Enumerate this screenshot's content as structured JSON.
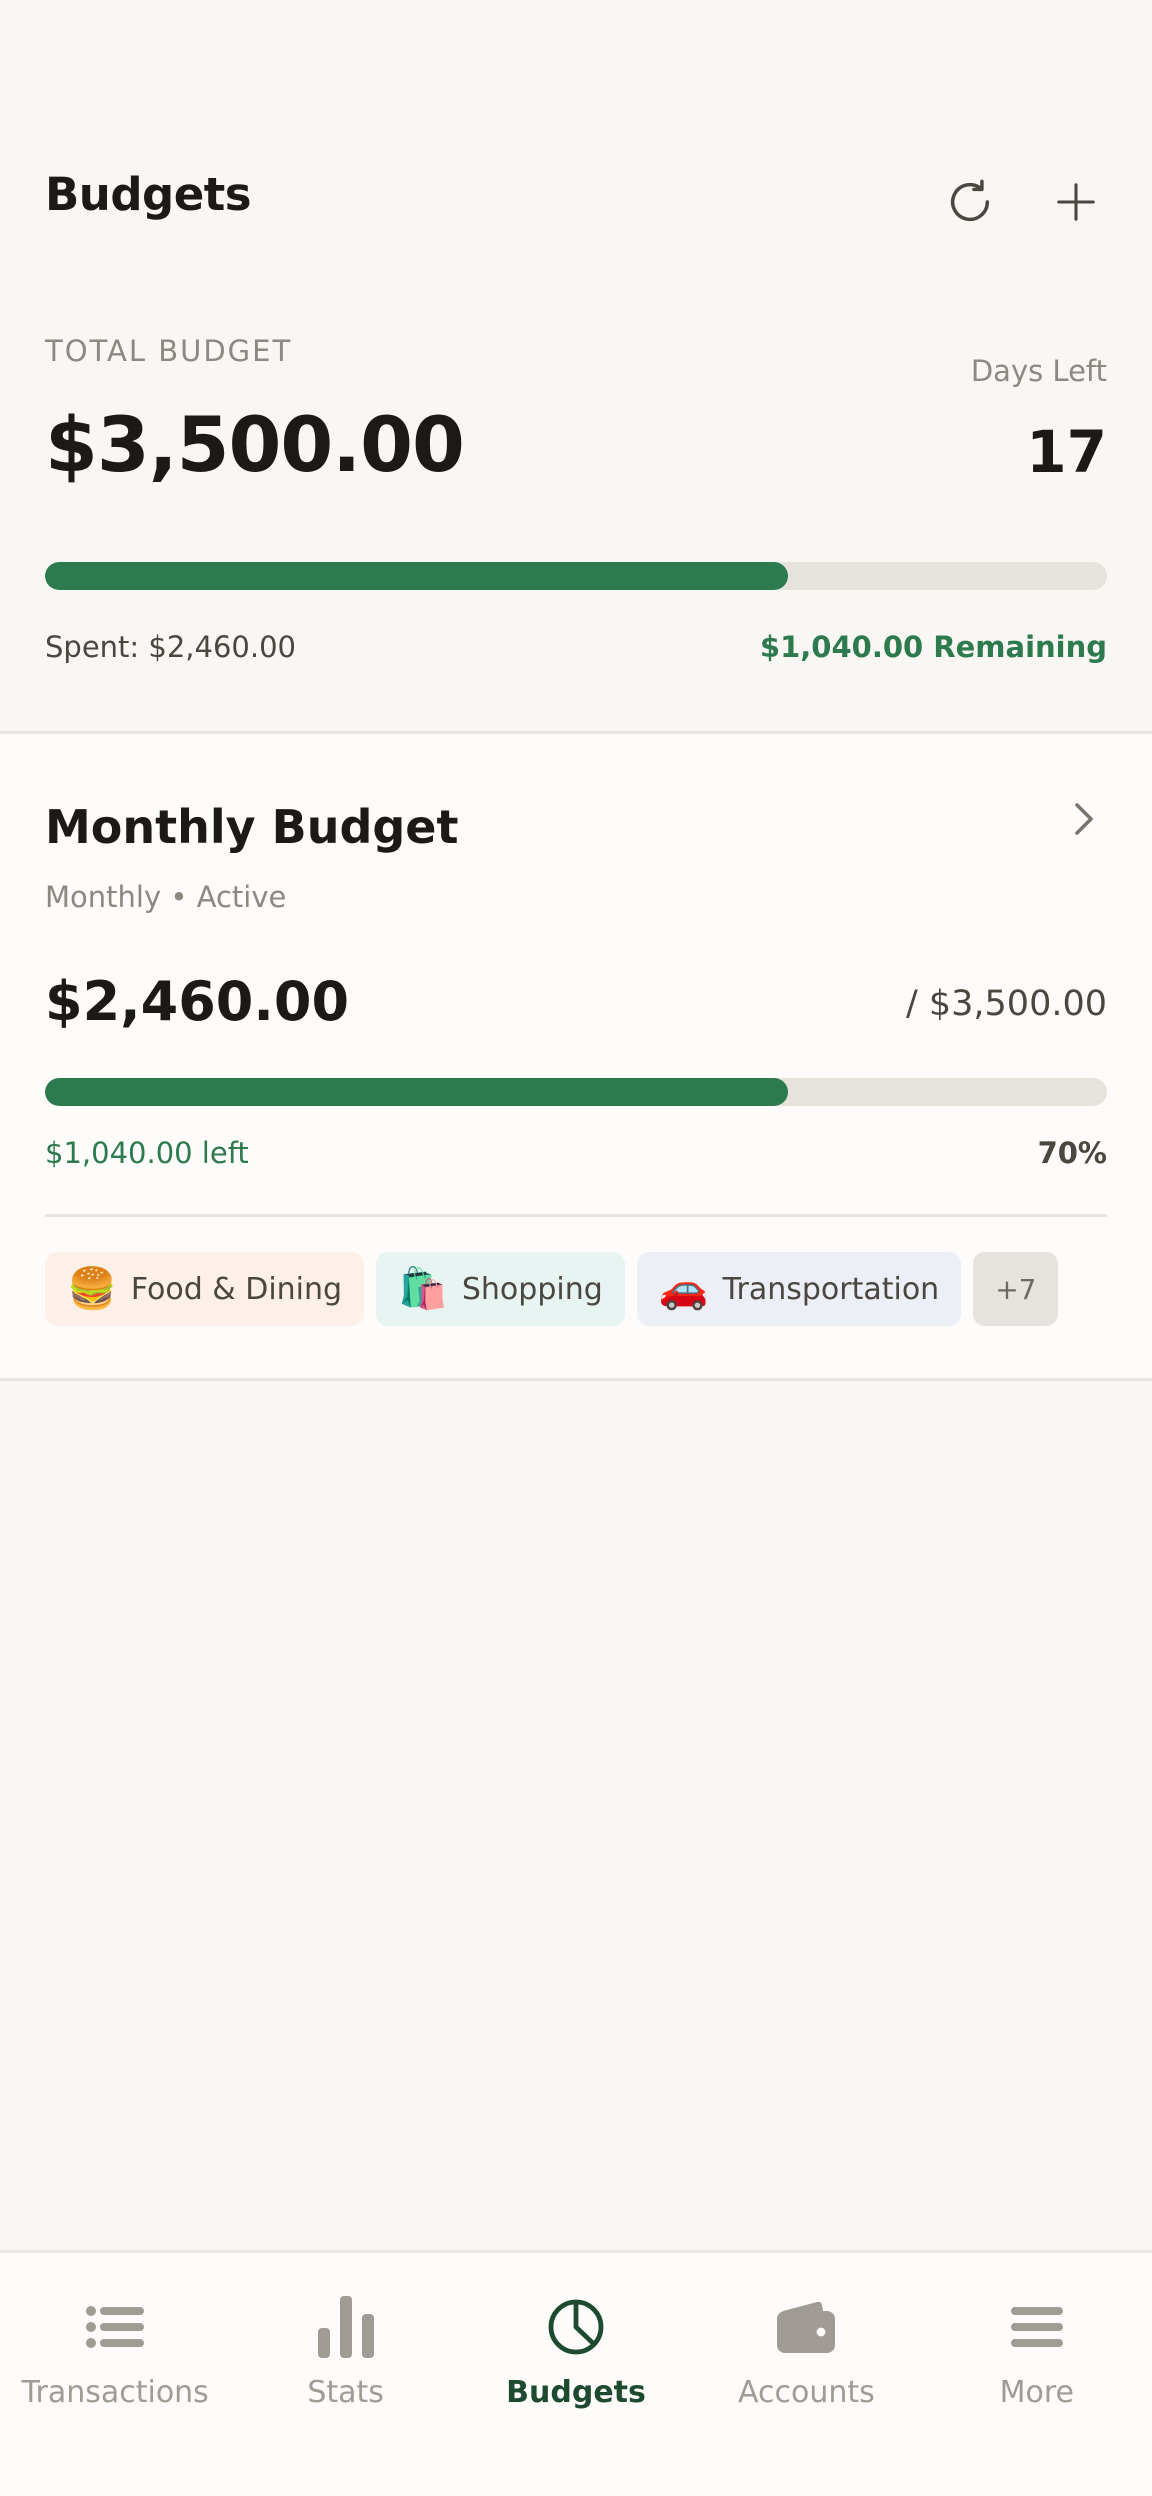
{
  "header": {
    "title": "Budgets",
    "refresh_icon": "refresh-icon",
    "add_icon": "plus-icon"
  },
  "summary": {
    "total_label": "TOTAL BUDGET",
    "total_amount": "$3,500.00",
    "days_left_label": "Days Left",
    "days_left_value": "17",
    "progress_percent": 70,
    "spent_text": "Spent: $2,460.00",
    "remaining_text": "$1,040.00 Remaining"
  },
  "budget_card": {
    "title": "Monthly Budget",
    "subtitle": "Monthly • Active",
    "spent": "$2,460.00",
    "limit": "/ $3,500.00",
    "progress_percent": 70,
    "left_text": "$1,040.00 left",
    "percent_text": "70%",
    "categories": [
      {
        "emoji": "🍔",
        "label": "Food & Dining"
      },
      {
        "emoji": "🛍️",
        "label": "Shopping"
      },
      {
        "emoji": "🚗",
        "label": "Transportation"
      }
    ],
    "more_label": "+7"
  },
  "nav": {
    "items": [
      {
        "label": "Transactions",
        "icon": "list-icon"
      },
      {
        "label": "Stats",
        "icon": "bar-chart-icon"
      },
      {
        "label": "Budgets",
        "icon": "pie-chart-icon",
        "active": true
      },
      {
        "label": "Accounts",
        "icon": "wallet-icon"
      },
      {
        "label": "More",
        "icon": "menu-icon"
      }
    ]
  },
  "colors": {
    "accent": "#2c7a4d",
    "track": "#e6e3dd",
    "nav_active": "#1e4a30",
    "nav_inactive": "#a09b94"
  }
}
